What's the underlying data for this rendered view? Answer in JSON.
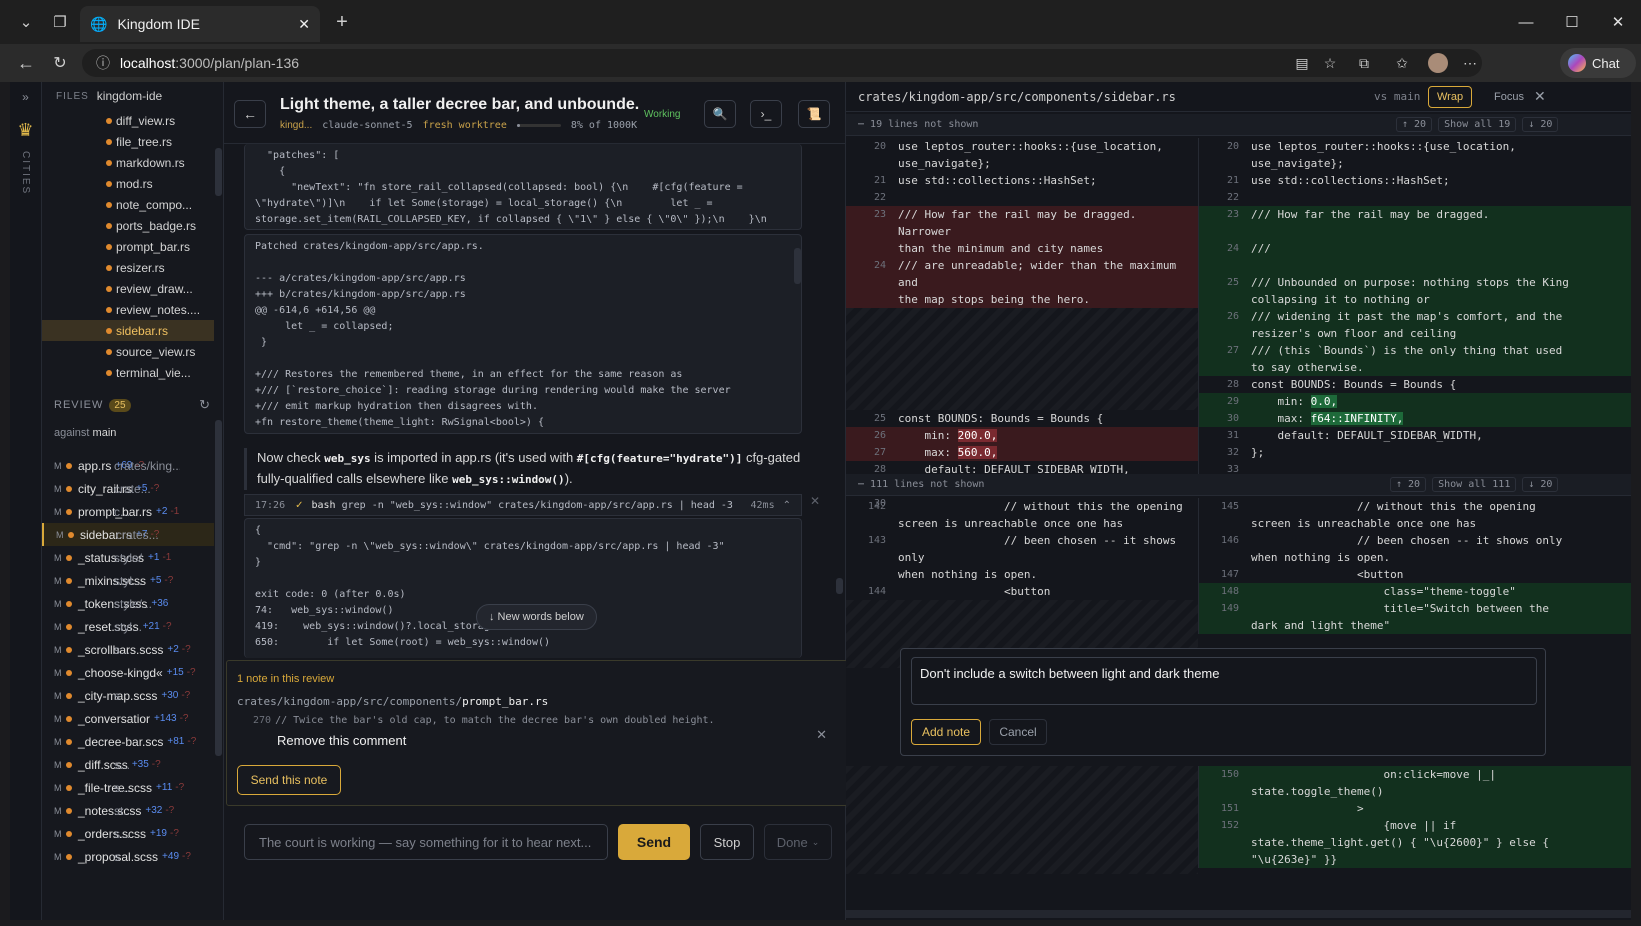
{
  "browser": {
    "tab_title": "Kingdom IDE",
    "url_host": "localhost",
    "url_path": ":3000/plan/plan-136",
    "chat_label": "Chat"
  },
  "rail": {
    "label": "CITIES"
  },
  "files": {
    "label": "FILES",
    "project": "kingdom-ide",
    "items": [
      "diff_view.rs",
      "file_tree.rs",
      "markdown.rs",
      "mod.rs",
      "note_compo...",
      "ports_badge.rs",
      "prompt_bar.rs",
      "resizer.rs",
      "review_draw...",
      "review_notes....",
      "sidebar.rs",
      "source_view.rs",
      "terminal_vie..."
    ],
    "selected_index": 10
  },
  "review": {
    "label": "REVIEW",
    "count": "25",
    "against_label": "against",
    "against_branch": "main",
    "items": [
      {
        "m": "M",
        "prefix": "crates/king...",
        "name": "app.rs",
        "add": "+69",
        "del": "-?"
      },
      {
        "m": "M",
        "prefix": "crate...",
        "name": "city_rail.rs",
        "add": "+5",
        "del": "-?"
      },
      {
        "m": "M",
        "prefix": "c...",
        "name": "prompt_bar.rs",
        "add": "+2",
        "del": "-1"
      },
      {
        "m": "M",
        "prefix": "crates...",
        "name": "sidebar.rs",
        "add": "+7",
        "del": "-?"
      },
      {
        "m": "M",
        "prefix": "style/",
        "name": "_status.scss",
        "add": "+1",
        "del": "-1"
      },
      {
        "m": "M",
        "prefix": "styl...",
        "name": "_mixins.scss",
        "add": "+5",
        "del": "-?"
      },
      {
        "m": "M",
        "prefix": "style/...",
        "name": "_tokens.scss",
        "add": "+36",
        "del": ""
      },
      {
        "m": "M",
        "prefix": "styl...",
        "name": "_reset.scss",
        "add": "+21",
        "del": "-?"
      },
      {
        "m": "M",
        "prefix": "s...",
        "name": "_scrollbars.scss",
        "add": "+2",
        "del": "-?"
      },
      {
        "m": "M",
        "prefix": "",
        "name": "_choose-kingd«",
        "add": "+15",
        "del": "-?"
      },
      {
        "m": "M",
        "prefix": "s",
        "name": "_city-map.scss",
        "add": "+30",
        "del": "-?"
      },
      {
        "m": "M",
        "prefix": "",
        "name": "_conversatior",
        "add": "+143",
        "del": "-?"
      },
      {
        "m": "M",
        "prefix": "",
        "name": "_decree-bar.scs",
        "add": "+81",
        "del": "-?"
      },
      {
        "m": "M",
        "prefix": "s...",
        "name": "_diff.scss",
        "add": "+35",
        "del": "-?"
      },
      {
        "m": "M",
        "prefix": "s...",
        "name": "_file-tree.scss",
        "add": "+11",
        "del": "-?"
      },
      {
        "m": "M",
        "prefix": "st...",
        "name": "_notes.scss",
        "add": "+32",
        "del": "-?"
      },
      {
        "m": "M",
        "prefix": "s...",
        "name": "_orders.scss",
        "add": "+19",
        "del": "-?"
      },
      {
        "m": "M",
        "prefix": "s",
        "name": "_proposal.scss",
        "add": "+49",
        "del": "-?"
      }
    ],
    "selected_index": 3
  },
  "plan": {
    "title": "Light theme, a taller decree bar, and unbounde...",
    "kingdom": "kingd...",
    "model": "claude-sonnet-5",
    "worktree": "fresh worktree",
    "progress_fraction": 0.08,
    "progress_label": "8% of 1000K",
    "status": "Working"
  },
  "chat": {
    "code1": "  \"patches\": [\n    {\n      \"newText\": \"fn store_rail_collapsed(collapsed: bool) {\\n    #[cfg(feature =\n\\\"hydrate\\\")]\\n    if let Some(storage) = local_storage() {\\n        let _ =\nstorage.set_item(RAIL_COLLAPSED_KEY, if collapsed { \\\"1\\\" } else { \\\"0\\\" });\\n    }\\n\n#[cfg(not(feature = \\\"hydrate\\\"))]\\n    let _ = collapsed;\\n}\\n\\n/// Restores the",
    "code2": "Patched crates/kingdom-app/src/app.rs.\n\n--- a/crates/kingdom-app/src/app.rs\n+++ b/crates/kingdom-app/src/app.rs\n@@ -614,6 +614,56 @@\n     let _ = collapsed;\n }\n\n+/// Restores the remembered theme, in an effect for the same reason as\n+/// [`restore_choice`]: reading storage during rendering would make the server\n+/// emit markup hydration then disagrees with.\n+fn restore_theme(theme_light: RwSignal<bool>) {",
    "prose_a": "Now check ",
    "prose_code1": "web_sys",
    "prose_b": " is imported in app.rs (it's used with ",
    "prose_code2": "#[cfg(feature=\"hydrate\")]",
    "prose_c": " cfg-gated fully-qualified calls elsewhere like ",
    "prose_code3": "web_sys::window()",
    "prose_d": ").",
    "tool_time": "17:26",
    "tool_check": "✓",
    "tool_name": "bash",
    "tool_cmd": "grep -n \"web_sys::window\" crates/kingdom-app/src/app.rs | head -3",
    "tool_ms": "42ms",
    "code3": "{\n  \"cmd\": \"grep -n \\\"web_sys::window\\\" crates/kingdom-app/src/app.rs | head -3\"\n}\n\nexit code: 0 (after 0.0s)\n74:   web_sys::window()\n419:    web_sys::window()?.local_storag\n650:        if let Some(root) = web_sys::window()",
    "new_words": "↓ New words below"
  },
  "note": {
    "title": "1 note in this review",
    "path_dir": "crates/kingdom-app/src/components/",
    "path_file": "prompt_bar.rs",
    "line_no": "270",
    "line_code": "// Twice the bar's old cap, to match the decree bar's own doubled height.",
    "text": "Remove this comment",
    "send_label": "Send this note"
  },
  "composer": {
    "placeholder": "The court is working — say something for it to hear next...",
    "send": "Send",
    "stop": "Stop",
    "done": "Done"
  },
  "diff": {
    "file": "crates/kingdom-app/src/components/sidebar.rs",
    "vs": "vs main",
    "wrap": "Wrap",
    "focus": "Focus",
    "hidden1": "19 lines not shown",
    "hidden1_up": "↑ 20",
    "hidden1_all": "Show all 19",
    "hidden1_down": "↓ 20",
    "hidden2": "111 lines not shown",
    "hidden2_up": "↑ 20",
    "hidden2_all": "Show all 111",
    "hidden2_down": "↓ 20",
    "note_text": "Don't include a switch between light and dark theme",
    "add_note": "Add note",
    "cancel": "Cancel"
  }
}
